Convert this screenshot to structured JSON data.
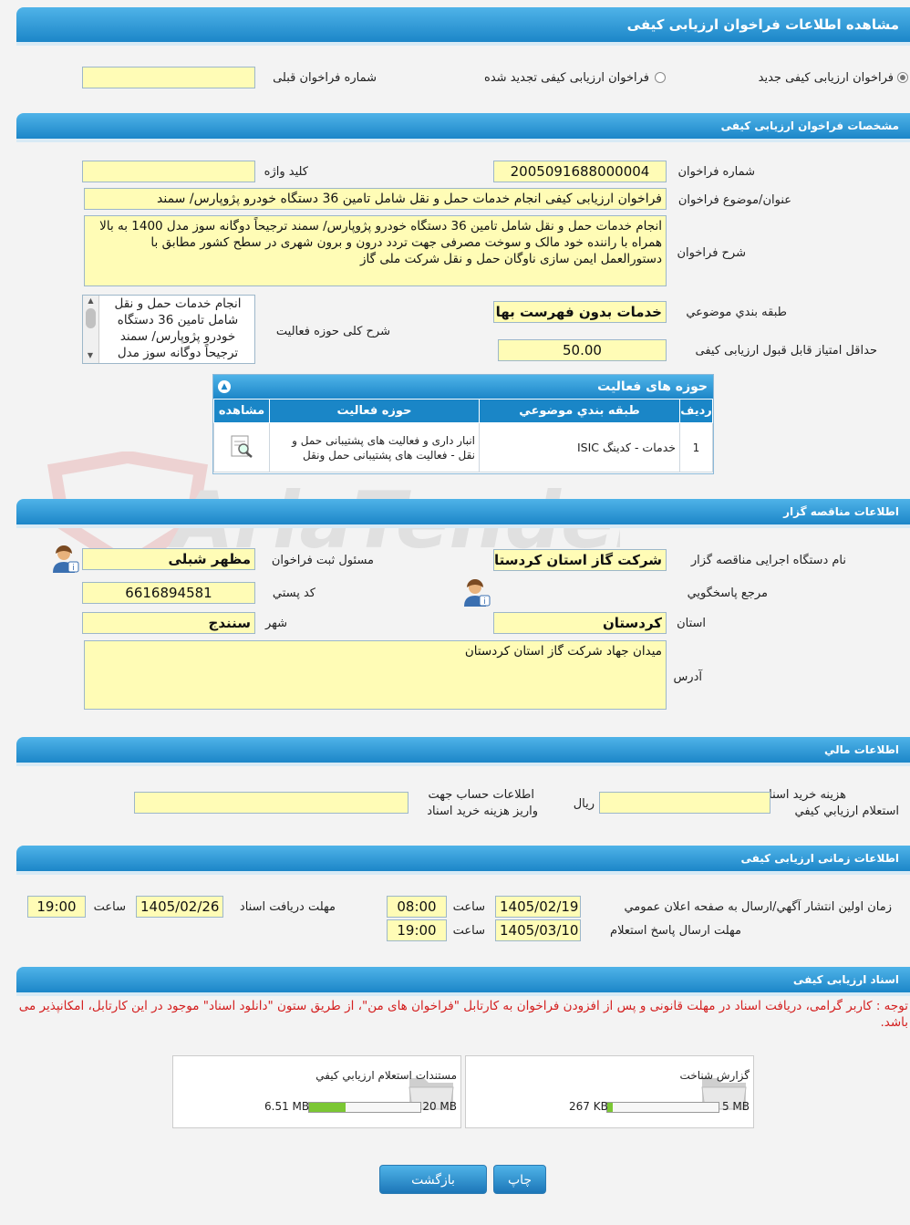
{
  "page": {
    "title": "مشاهده اطلاعات فراخوان ارزیابی کیفی"
  },
  "type_row": {
    "radio_new": "فراخوان ارزیابی کیفی جدید",
    "radio_renewed": "فراخوان ارزیابی کیفی تجدید شده",
    "previous_number_label": "شماره فراخوان قبلی",
    "previous_number_value": ""
  },
  "spec": {
    "section_title": "مشخصات فراخوان ارزیابی کیفی",
    "number_label": "شماره فراخوان",
    "number_value": "2005091688000004",
    "keyword_label": "کلید واژه",
    "keyword_value": "",
    "subject_label": "عنوان/موضوع فراخوان",
    "subject_value": "فراخوان ارزیابی کیفی انجام خدمات حمل و نقل شامل تامین 36 دستگاه خودرو پژوپارس/ سمند",
    "desc_label": "شرح فراخوان",
    "desc_value": "انجام خدمات حمل و نقل شامل تامین 36 دستگاه خودرو پژوپارس/ سمند ترجیحاً دوگانه سوز مدل 1400 به بالا همراه با راننده خود مالک و سوخت مصرفی جهت تردد درون و برون شهری در سطح کشور مطابق با دستورالعمل ایمن سازی ناوگان حمل و نقل شرکت ملی گاز",
    "category_label": "طبقه بندي موضوعي",
    "category_value": "خدمات بدون فهرست بها",
    "activity_label": "شرح کلی حوزه فعالیت",
    "activity_value": "انجام خدمات حمل و نقل شامل تامین 36 دستگاه خودرو پژوپارس/ سمند ترجیحاً دوگانه سوز مدل",
    "min_score_label": "حداقل امتیاز قابل قبول ارزیابی کیفی",
    "min_score_value": "50.00"
  },
  "activities": {
    "title": "حوزه های فعالیت",
    "headers": {
      "row": "رديف",
      "category": "طبقه بندي موضوعي",
      "field": "حوزه فعالیت",
      "view": "مشاهده"
    },
    "rows": [
      {
        "row": "1",
        "category": "خدمات - کدینگ ISIC",
        "field": "انبار داری و فعالیت های پشتیبانی حمل و نقل - فعالیت های پشتیبانی حمل ونقل"
      }
    ]
  },
  "organizer": {
    "section_title": "اطلاعات مناقصه گزار",
    "org_label": "نام دستگاه اجرایی مناقصه گزار",
    "org_value": "شرکت گاز استان کردستان",
    "registrar_label": "مسئول ثبت فراخوان",
    "registrar_value": "مظهر  شبلی",
    "reference_label": "مرجع پاسخگويي",
    "postal_label": "کد پستي",
    "postal_value": "6616894581",
    "province_label": "استان",
    "province_value": "کردستان",
    "city_label": "شهر",
    "city_value": "سنندج",
    "address_label": "آدرس",
    "address_value": "میدان جهاد شرکت گاز استان کردستان"
  },
  "financial": {
    "section_title": "اطلاعات مالي",
    "fee_label_1": "هزینه خرید اسناد",
    "fee_label_2": "استعلام ارزيابي کيفي",
    "fee_value": "",
    "currency": "ريال",
    "account_label_1": "اطلاعات حساب جهت",
    "account_label_2": "واریز هزینه خرید اسناد",
    "account_value": ""
  },
  "timing": {
    "section_title": "اطلاعات زمانی ارزیابی کیفی",
    "publish_label": "زمان اولين انتشار آگهي/ارسال به صفحه اعلان عمومي",
    "publish_date": "1405/02/19",
    "publish_time": "08:00",
    "time_label": "ساعت",
    "receive_label": "مهلت دریافت اسناد",
    "receive_date": "1405/02/26",
    "receive_time": "19:00",
    "reply_label": "مهلت ارسال پاسخ استعلام",
    "reply_date": "1405/03/10",
    "reply_time": "19:00"
  },
  "documents": {
    "section_title": "اسناد ارزیابی کیفی",
    "notice": "توجه : کاربر گرامی، دریافت اسناد در مهلت قانونی و پس از افزودن فراخوان به کارتابل \"فراخوان های من\"، از طریق ستون \"دانلود اسناد\" موجود در این کارتابل، امکانپذیر می باشد.",
    "files": [
      {
        "name": "گزارش شناخت",
        "size": "267 KB",
        "max": "5 MB",
        "fraction": 0.05
      },
      {
        "name": "مستندات استعلام ارزيابي کيفي",
        "size": "6.51 MB",
        "max": "20 MB",
        "fraction": 0.33
      }
    ]
  },
  "buttons": {
    "print": "چاپ",
    "back": "بازگشت"
  },
  "watermark": "AriaTender.neT",
  "colors": {
    "header": "#1c86c8",
    "field_bg": "#fffcb6",
    "notice": "#d42020"
  }
}
